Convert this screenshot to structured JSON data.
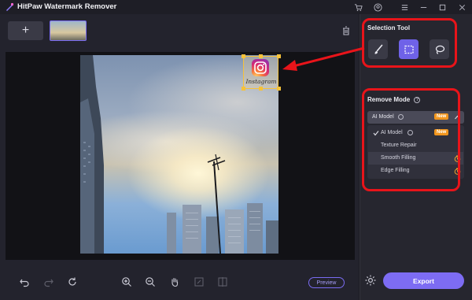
{
  "app": {
    "title": "HitPaw Watermark Remover"
  },
  "toolbar": {
    "add_label": "+"
  },
  "watermark": {
    "text": "Instagram"
  },
  "selection_tool": {
    "title": "Selection Tool",
    "tools": [
      "brush-tool",
      "rectangle-tool",
      "lasso-tool"
    ],
    "active": "rectangle-tool"
  },
  "remove_mode": {
    "title": "Remove Mode",
    "selected": "AI Model",
    "selected_badge": "New",
    "options": [
      {
        "label": "AI Model",
        "checked": true,
        "badge": "New"
      },
      {
        "label": "Texture Repair"
      },
      {
        "label": "Smooth Filling",
        "timer": true
      },
      {
        "label": "Edge Filling",
        "timer": true
      }
    ]
  },
  "bottom": {
    "preview_label": "Preview",
    "export_label": "Export"
  },
  "colors": {
    "accent": "#7d6cf3",
    "annotation": "#e8141a",
    "badge": "#f2961e"
  }
}
